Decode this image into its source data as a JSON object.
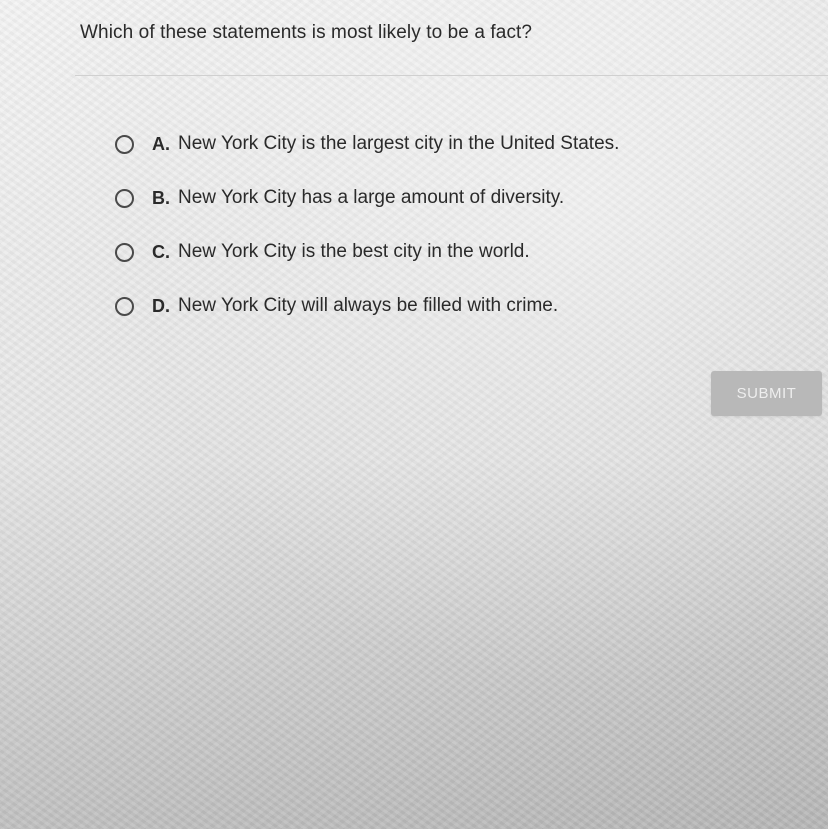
{
  "question": {
    "text": "Which of these statements is most likely to be a fact?"
  },
  "options": [
    {
      "letter": "A.",
      "text": "New York City is the largest city in the United States.",
      "selected": false
    },
    {
      "letter": "B.",
      "text": "New York City has a large amount of diversity.",
      "selected": false
    },
    {
      "letter": "C.",
      "text": "New York City is the best city in the world.",
      "selected": false
    },
    {
      "letter": "D.",
      "text": "New York City will always be filled with crime.",
      "selected": false
    }
  ],
  "submit": {
    "label": "SUBMIT",
    "enabled": false
  },
  "colors": {
    "submit_bg": "#b8b8b8",
    "text": "#2a2a2a"
  }
}
